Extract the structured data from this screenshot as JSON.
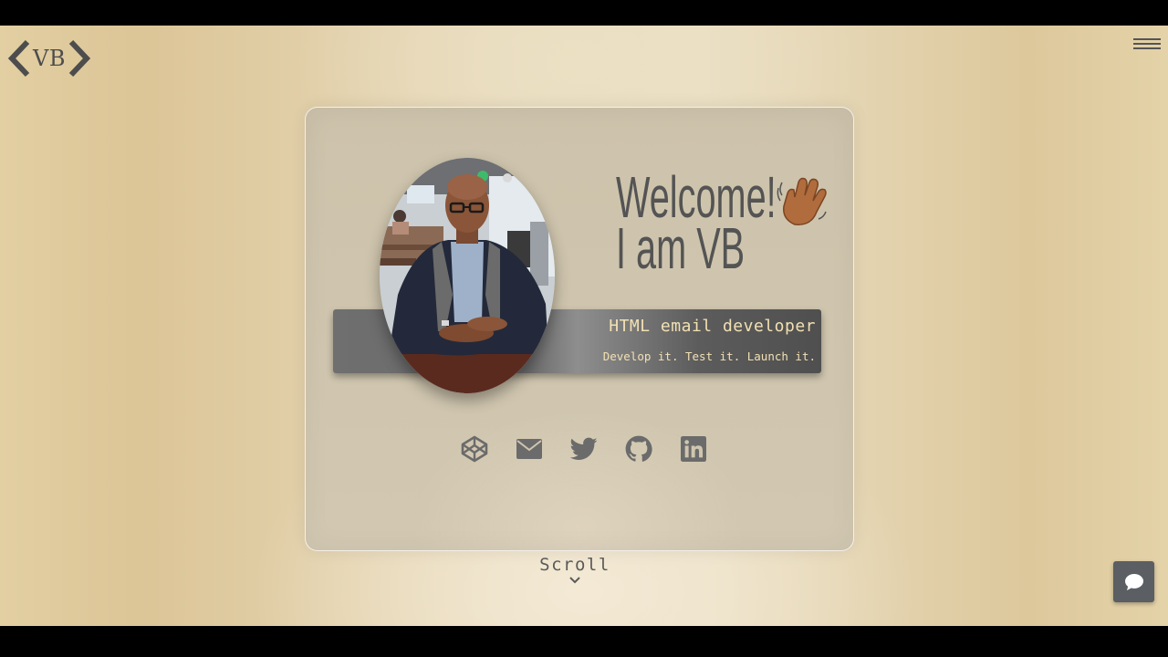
{
  "header": {
    "logo_text": "VB",
    "logo_icon": "code-brackets-icon",
    "menu_icon": "hamburger-menu-icon"
  },
  "hero": {
    "greeting": "Welcome!",
    "greeting_emoji": "waving-hand-icon",
    "intro": "I am VB",
    "role": "HTML email developer",
    "tagline": "Develop it. Test it. Launch it.",
    "photo": "profile-photo"
  },
  "social_links": [
    {
      "icon": "codepen-icon"
    },
    {
      "icon": "email-icon"
    },
    {
      "icon": "twitter-icon"
    },
    {
      "icon": "github-icon"
    },
    {
      "icon": "linkedin-icon"
    }
  ],
  "scroll": {
    "label": "Scroll",
    "icon": "chevron-down-icon"
  },
  "chat": {
    "icon": "chat-bubble-icon"
  },
  "colors": {
    "text_dark": "#545454",
    "banner_text": "#f2e0b3",
    "icon_gray": "#6b6b6b",
    "chat_bg": "#5b5e62"
  }
}
